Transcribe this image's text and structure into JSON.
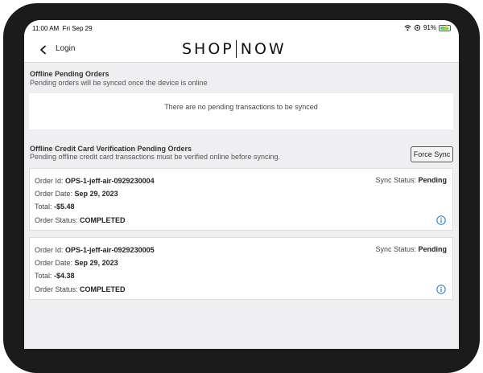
{
  "status_bar": {
    "time": "11:00 AM",
    "date": "Fri Sep 29",
    "battery": "91%",
    "icons": [
      "wifi-icon",
      "location-icon",
      "battery-charging-icon"
    ]
  },
  "nav": {
    "back_label": "Login",
    "logo_left": "SHOP",
    "logo_right": "NOW",
    "back_icon": "chevron-left-icon"
  },
  "offline_pending": {
    "title": "Offline Pending Orders",
    "subtitle": "Pending orders will be synced once the device is online",
    "empty_message": "There are no pending transactions to be synced"
  },
  "cc_pending": {
    "title": "Offline Credit Card Verification Pending Orders",
    "subtitle": "Pending offline credit card transactions must be verified online before syncing.",
    "force_sync_label": "Force Sync"
  },
  "labels": {
    "order_id": "Order Id:",
    "order_date": "Order Date:",
    "total": "Total:",
    "order_status": "Order Status:",
    "sync_status": "Sync Status:"
  },
  "orders": [
    {
      "id": "OPS-1-jeff-air-0929230004",
      "date": "Sep 29, 2023",
      "total": "-$5.48",
      "status": "COMPLETED",
      "sync_status": "Pending"
    },
    {
      "id": "OPS-1-jeff-air-0929230005",
      "date": "Sep 29, 2023",
      "total": "-$4.38",
      "status": "COMPLETED",
      "sync_status": "Pending"
    }
  ],
  "colors": {
    "accent": "#1a73c8",
    "background": "#efeff1",
    "battery": "#4cd964"
  }
}
